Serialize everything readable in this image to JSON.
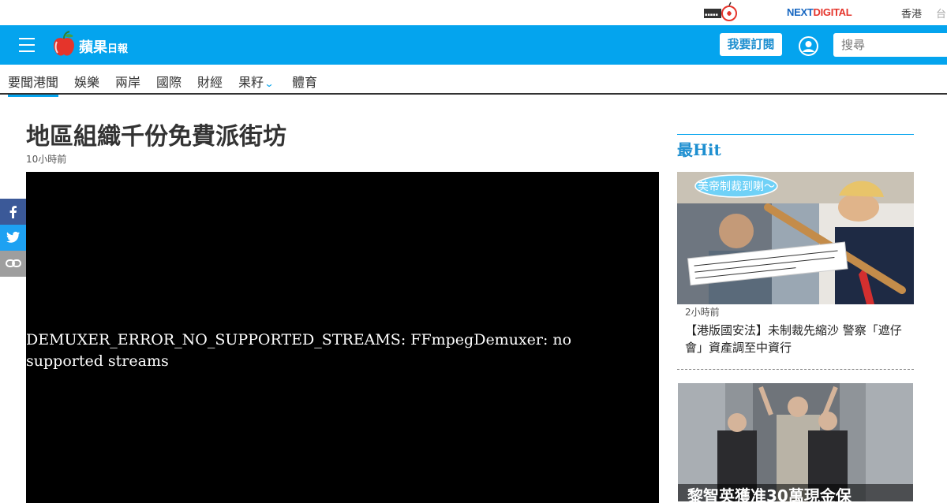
{
  "topbar": {
    "logo_icon": "apple-daily-small-logo",
    "nextdigital_prefix": "NEXT",
    "nextdigital_suffix": "DIGITAL",
    "region_hk": "香港",
    "region_tw": "台"
  },
  "header": {
    "menu_icon": "hamburger-icon",
    "brand_name": "蘋果",
    "brand_suffix": "日報",
    "subscribe_label": "我要訂閱",
    "user_icon": "user-icon",
    "search_placeholder": "搜尋"
  },
  "nav": {
    "items": [
      {
        "label": "要聞港聞",
        "active": true
      },
      {
        "label": "娛樂"
      },
      {
        "label": "兩岸"
      },
      {
        "label": "國際"
      },
      {
        "label": "財經"
      },
      {
        "label": "果籽"
      },
      {
        "label": "體育"
      }
    ],
    "dropdown_icon": "chevron-down-icon"
  },
  "social": [
    "facebook-icon",
    "twitter-icon",
    "link-icon"
  ],
  "article": {
    "title": "地區組織千份免費派街坊",
    "time": "10小時前",
    "video_error": "DEMUXER_ERROR_NO_SUPPORTED_STREAMS: FFmpegDemuxer: no supported streams"
  },
  "sidebar": {
    "heading": "最Hit",
    "items": [
      {
        "time": "2小時前",
        "title": "【港版國安法】未制裁先縮沙 警察「遮仔會」資產調至中資行",
        "image_caption": "美帝制裁到喇～"
      },
      {
        "image_caption": "黎智英獲准30萬現金保"
      }
    ]
  },
  "colors": {
    "header_blue": "#04a4ee",
    "brand_accent": "#1e8fd0",
    "facebook": "#3b5998",
    "twitter": "#1da1f2",
    "link_grey": "#9e9e9e"
  }
}
